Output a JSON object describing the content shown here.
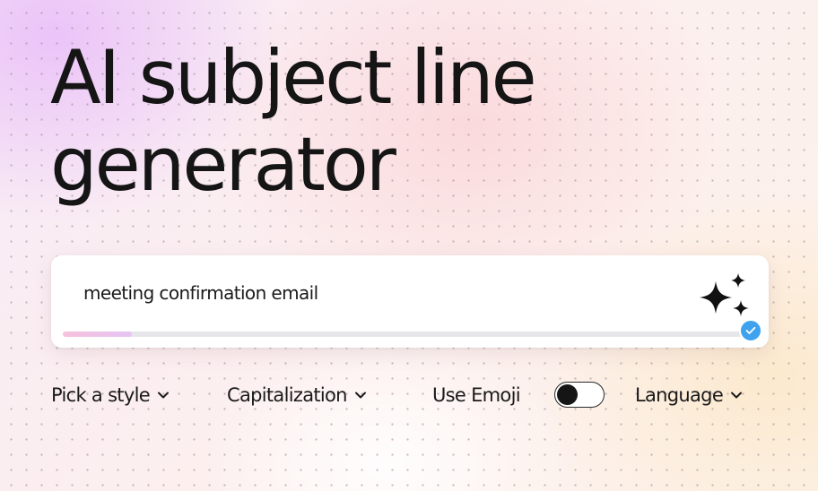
{
  "hero": {
    "title_line1": "AI subject line",
    "title_line2": "generator"
  },
  "input_card": {
    "value": "meeting confirmation email",
    "placeholder": "",
    "progress": 0.1,
    "generate_icon": "sparkle-icon",
    "status_icon": "check-icon",
    "status_color": "#3fa2ee"
  },
  "options": {
    "style_label": "Pick a style",
    "capitalization_label": "Capitalization",
    "emoji_label": "Use Emoji",
    "emoji_enabled": false,
    "language_label": "Language",
    "dropdown_icon": "chevron-down-icon"
  },
  "colors": {
    "text": "#151515",
    "progress_fill": "#f0c3e6",
    "progress_track": "#e7e7e9"
  }
}
